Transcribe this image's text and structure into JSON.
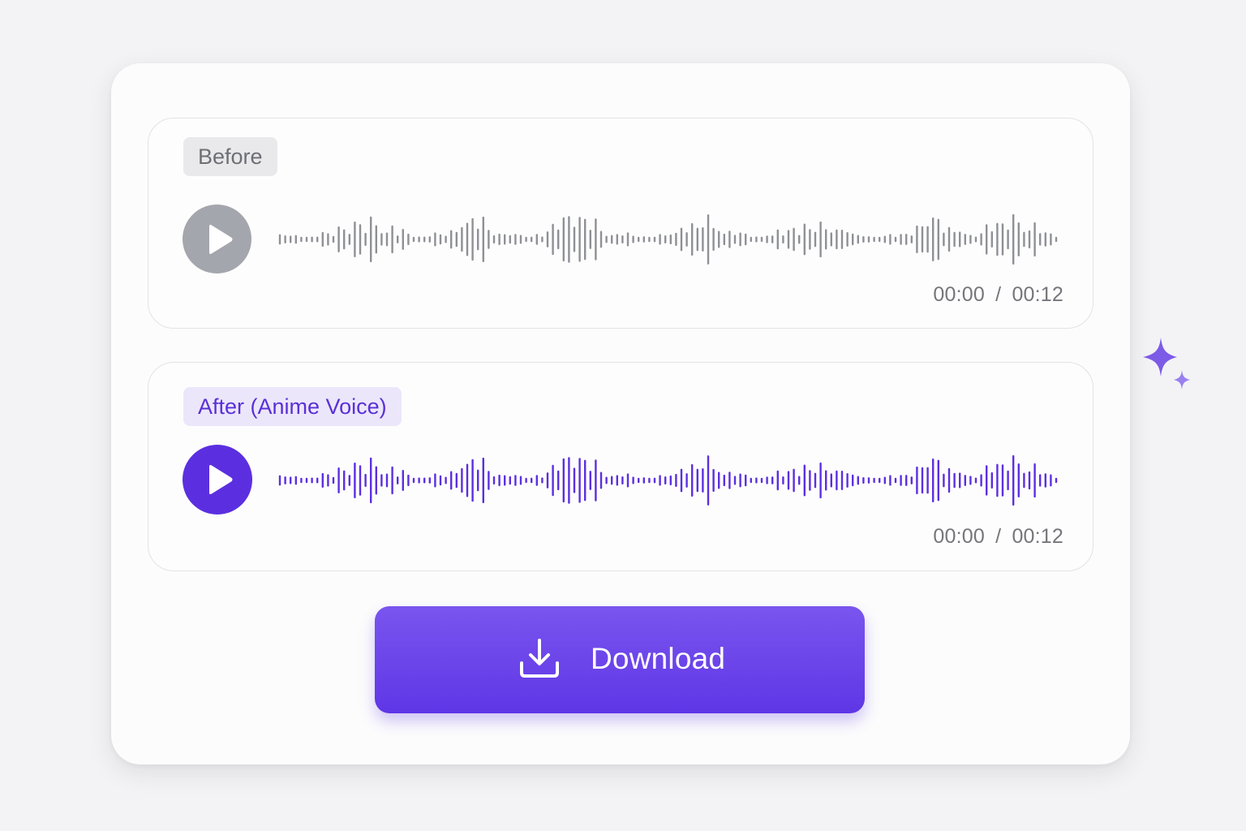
{
  "before": {
    "label": "Before",
    "time_current": "00:00",
    "time_separator": "/",
    "time_total": "00:12",
    "icon": "play-icon",
    "color": "#8f9096",
    "button_color": "#a4a6ad"
  },
  "after": {
    "label": "After (Anime Voice)",
    "time_current": "00:00",
    "time_separator": "/",
    "time_total": "00:12",
    "icon": "play-icon",
    "color": "#5b2fe0",
    "button_color": "#5b2fe0"
  },
  "download": {
    "label": "Download",
    "icon": "download-icon",
    "color": "#6a41ea"
  },
  "decor": {
    "icon": "sparkle-icon",
    "color": "#7c5be6"
  }
}
